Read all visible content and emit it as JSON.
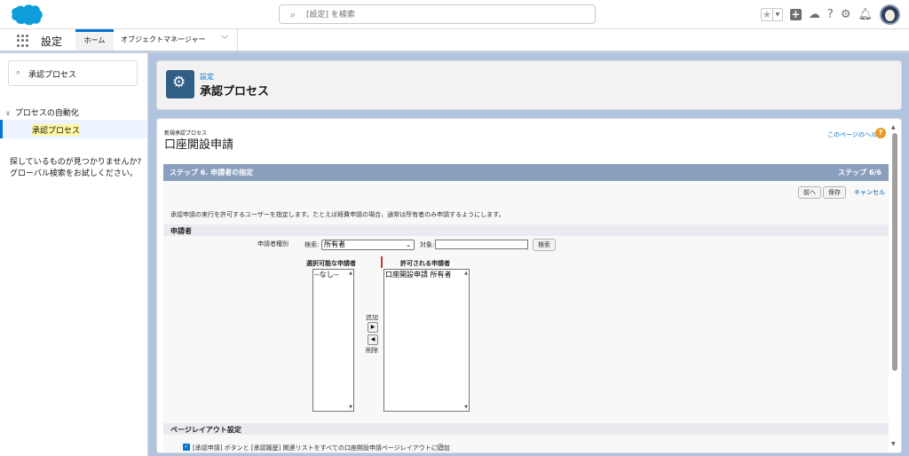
{
  "header": {
    "search_placeholder": "[設定] を検索",
    "icons": [
      "favorites-star-icon",
      "favorites-dropdown-icon",
      "global-actions-icon",
      "trailhead-icon",
      "help-icon",
      "setup-gear-icon",
      "notifications-bell-icon",
      "user-avatar"
    ]
  },
  "context": {
    "app_name": "設定",
    "tabs": [
      "ホーム",
      "オブジェクトマネージャー"
    ]
  },
  "sidebar": {
    "quickfind_value": "承認プロセス",
    "section": "プロセスの自動化",
    "active_item": "承認プロセス",
    "help_text": "探しているものが見つかりませんか? グローバル検索をお試しください。"
  },
  "page_header": {
    "breadcrumb": "設定",
    "title": "承認プロセス"
  },
  "content": {
    "subtitle": "新規承認プロセス",
    "title": "口座開設申請",
    "help_link": "このページのヘルプ",
    "step_title": "ステップ 6. 申請者の指定",
    "step_count": "ステップ 6/6",
    "buttons": {
      "prev": "前へ",
      "save": "保存",
      "cancel": "キャンセル"
    },
    "description": "承認申請の実行を許可するユーザーを指定します。たとえば経費申請の場合、通常は所有者のみ申請するようにします。",
    "submitters_section": "申請者",
    "submitter_type_label": "申請者種別",
    "search_label": "検索:",
    "search_select_value": "所有者",
    "target_label": "対象:",
    "search_button": "検索",
    "available_header": "選択可能な申請者",
    "allowed_header": "許可される申請者",
    "available_items": [
      "--なし--"
    ],
    "allowed_items": [
      "口座開設申請 所有者"
    ],
    "add_label": "追加",
    "remove_label": "削除",
    "layout_section": "ページレイアウト設定",
    "layout_checkbox_label": "[承認申請] ボタンと [承認履歴] 関連リストをすべての口座開設申請ページレイアウトに追加"
  },
  "colors": {
    "brand_blue": "#0176d3",
    "step_bar": "#8a9ebe",
    "page_icon": "#305e85",
    "help_icon": "#e99a24"
  }
}
